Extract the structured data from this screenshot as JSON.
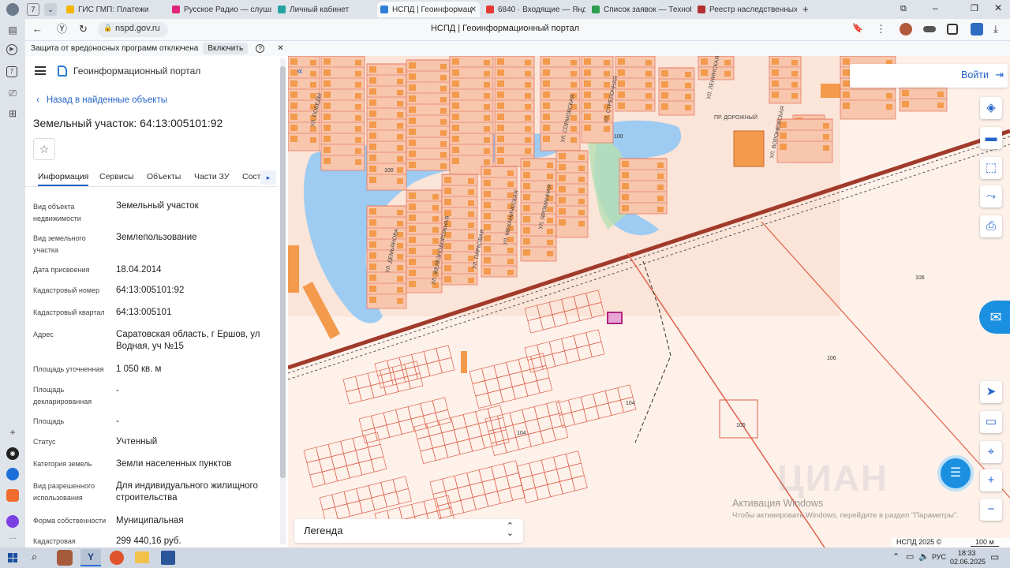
{
  "browser": {
    "tab_count": "7",
    "tabs": [
      {
        "title": "ГИС ГМП: Платежи",
        "color": "#f5b400"
      },
      {
        "title": "Русское Радио — слушать",
        "color": "#e0257a"
      },
      {
        "title": "Личный кабинет",
        "color": "#26a3a3"
      },
      {
        "title": "НСПД | Геоинформац",
        "color": "#2d7fd6",
        "active": true
      },
      {
        "title": "6840 · Входящие — Яндекс",
        "color": "#e53935"
      },
      {
        "title": "Список заявок — ТехноК",
        "color": "#2e9e4f"
      },
      {
        "title": "Реестр наследственных д",
        "color": "#b23030"
      }
    ],
    "url": "nspd.gov.ru",
    "page_title": "НСПД | Геоинформационный портал",
    "infobar_text": "Защита от вредоносных программ отключена",
    "infobar_button": "Включить"
  },
  "portal": {
    "title": "Геоинформационный портал"
  },
  "panel": {
    "back_label": "Назад в найденные объекты",
    "heading": "Земельный участок: 64:13:005101:92",
    "tabs": [
      "Информация",
      "Сервисы",
      "Объекты",
      "Части ЗУ",
      "Соста"
    ],
    "fields": [
      {
        "label": "Вид объекта недвижимости",
        "value": "Земельный участок"
      },
      {
        "label": "Вид земельного участка",
        "value": "Землепользование"
      },
      {
        "label": "Дата присвоения",
        "value": "18.04.2014"
      },
      {
        "label": "Кадастровый номер",
        "value": "64:13:005101:92"
      },
      {
        "label": "Кадастровый квартал",
        "value": "64:13:005101"
      },
      {
        "label": "Адрес",
        "value": "Саратовская область, г Ершов, ул Водная, уч №15"
      },
      {
        "label": "Площадь уточненная",
        "value": "1 050 кв. м"
      },
      {
        "label": "Площадь декларированная",
        "value": "-"
      },
      {
        "label": "Площадь",
        "value": "-"
      },
      {
        "label": "Статус",
        "value": "Учтенный"
      },
      {
        "label": "Категория земель",
        "value": "Земли населенных пунктов"
      },
      {
        "label": "Вид разрешенного использования",
        "value": "Для индивидуального жилищного строительства"
      },
      {
        "label": "Форма собственности",
        "value": "Муниципальная"
      },
      {
        "label": "Кадастровая",
        "value": "299 440,16 руб."
      }
    ]
  },
  "map": {
    "login": "Войти",
    "legend": "Легенда",
    "copyright": "НСПД 2025 ©",
    "scale": "100 м",
    "watermark": "ЦИАН",
    "activation_title": "Активация Windows",
    "activation_text": "Чтобы активировать Windows, перейдите в раздел \"Параметры\".",
    "streets": [
      "УЛ. ПОБЕДЫ",
      "УЛ. ЖЕЛЕЗНОДОРОЖНАЯ",
      "УЛ. ДЕМЬЯНОВА",
      "УЛ. ПАРКОВАЯ",
      "УЛ. МЕХАНИЧЕСКАЯ",
      "УЛ. ЯРОМАННАЯ",
      "УЛ. СОРМОВСКАЯ",
      "УЛ. СТРЕЛОЧНАЯ",
      "УЛ. ЛЕНИНСКАЯ",
      "ПР. ДОРОЖНЫЙ",
      "УЛ. ВОРОНЕЖСКАЯ"
    ],
    "block_labels": [
      "106",
      "106",
      "104",
      "104",
      "105"
    ],
    "water_labels": [
      "100",
      "100"
    ]
  },
  "taskbar": {
    "time": "18:33",
    "date": "02.06.2025",
    "lang": "РУС"
  },
  "colors": {
    "accent": "#2563c9",
    "building": "#f39a4c",
    "parcel_line": "#e0614a",
    "water": "#9ecbf1",
    "park": "#b8e0b2",
    "road": "#a03a2a"
  }
}
